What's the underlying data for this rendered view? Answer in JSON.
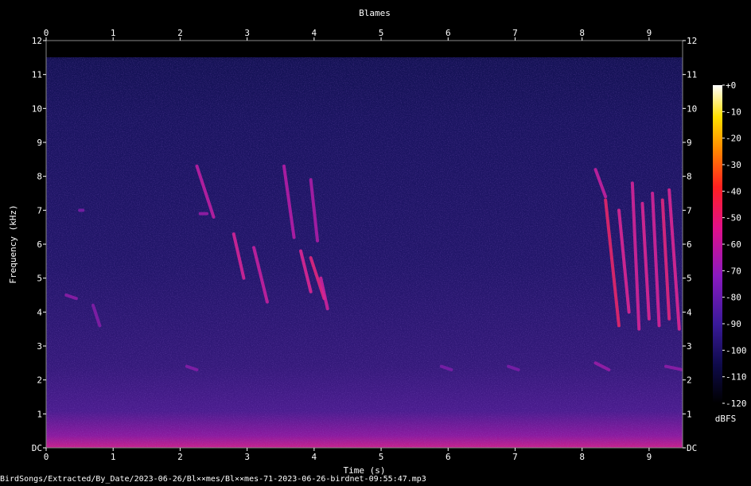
{
  "chart_data": {
    "type": "heatmap",
    "title": "Blames",
    "xlabel": "Time (s)",
    "ylabel": "Frequency (kHz)",
    "xlim": [
      0,
      9.5
    ],
    "ylim": [
      0,
      12
    ],
    "x_ticks": [
      "0",
      "1",
      "2",
      "3",
      "4",
      "5",
      "6",
      "7",
      "8",
      "9"
    ],
    "y_ticks": [
      "DC",
      "1",
      "2",
      "3",
      "4",
      "5",
      "6",
      "7",
      "8",
      "9",
      "10",
      "11",
      "12"
    ],
    "colorbar": {
      "label": "dBFS",
      "range": [
        -120,
        0
      ],
      "ticks": [
        "+0",
        "-10",
        "-20",
        "-30",
        "-40",
        "-50",
        "-60",
        "-70",
        "-80",
        "-90",
        "-100",
        "-110",
        "-120"
      ]
    },
    "colors": {
      "background": "#000000",
      "text": "#ffffff",
      "plot_floor": "#1a1660"
    },
    "calls": [
      {
        "t0": 0.3,
        "t1": 0.45,
        "f0": 4.5,
        "f1": 4.4,
        "db": -78
      },
      {
        "t0": 0.7,
        "t1": 0.8,
        "f0": 4.2,
        "f1": 3.6,
        "db": -80
      },
      {
        "t0": 0.5,
        "t1": 0.55,
        "f0": 7.0,
        "f1": 7.0,
        "db": -82
      },
      {
        "t0": 2.25,
        "t1": 2.5,
        "f0": 8.3,
        "f1": 6.8,
        "db": -68
      },
      {
        "t0": 2.8,
        "t1": 2.95,
        "f0": 6.3,
        "f1": 5.0,
        "db": -62
      },
      {
        "t0": 3.1,
        "t1": 3.3,
        "f0": 5.9,
        "f1": 4.3,
        "db": -66
      },
      {
        "t0": 3.55,
        "t1": 3.7,
        "f0": 8.3,
        "f1": 6.2,
        "db": -70
      },
      {
        "t0": 3.95,
        "t1": 4.05,
        "f0": 7.9,
        "f1": 6.1,
        "db": -72
      },
      {
        "t0": 3.8,
        "t1": 3.95,
        "f0": 5.8,
        "f1": 4.6,
        "db": -60
      },
      {
        "t0": 3.95,
        "t1": 4.15,
        "f0": 5.6,
        "f1": 4.4,
        "db": -58
      },
      {
        "t0": 4.1,
        "t1": 4.2,
        "f0": 5.0,
        "f1": 4.1,
        "db": -64
      },
      {
        "t0": 2.3,
        "t1": 2.4,
        "f0": 6.9,
        "f1": 6.9,
        "db": -76
      },
      {
        "t0": 2.1,
        "t1": 2.25,
        "f0": 2.4,
        "f1": 2.3,
        "db": -80
      },
      {
        "t0": 5.9,
        "t1": 6.05,
        "f0": 2.4,
        "f1": 2.3,
        "db": -82
      },
      {
        "t0": 6.9,
        "t1": 7.05,
        "f0": 2.4,
        "f1": 2.3,
        "db": -82
      },
      {
        "t0": 8.2,
        "t1": 8.35,
        "f0": 8.2,
        "f1": 7.4,
        "db": -66
      },
      {
        "t0": 8.35,
        "t1": 8.55,
        "f0": 7.3,
        "f1": 3.6,
        "db": -56
      },
      {
        "t0": 8.55,
        "t1": 8.7,
        "f0": 7.0,
        "f1": 4.0,
        "db": -60
      },
      {
        "t0": 8.75,
        "t1": 8.85,
        "f0": 7.8,
        "f1": 3.5,
        "db": -62
      },
      {
        "t0": 8.9,
        "t1": 9.0,
        "f0": 7.2,
        "f1": 3.8,
        "db": -60
      },
      {
        "t0": 9.05,
        "t1": 9.15,
        "f0": 7.5,
        "f1": 3.6,
        "db": -62
      },
      {
        "t0": 9.2,
        "t1": 9.3,
        "f0": 7.3,
        "f1": 3.8,
        "db": -58
      },
      {
        "t0": 9.3,
        "t1": 9.45,
        "f0": 7.6,
        "f1": 3.5,
        "db": -60
      },
      {
        "t0": 8.2,
        "t1": 8.4,
        "f0": 2.5,
        "f1": 2.3,
        "db": -76
      },
      {
        "t0": 9.25,
        "t1": 9.5,
        "f0": 2.4,
        "f1": 2.3,
        "db": -78
      }
    ]
  },
  "footer": {
    "file_path": "BirdSongs/Extracted/By_Date/2023-06-26/Bl××mes/Bl××mes-71-2023-06-26-birdnet-09:55:47.mp3"
  }
}
